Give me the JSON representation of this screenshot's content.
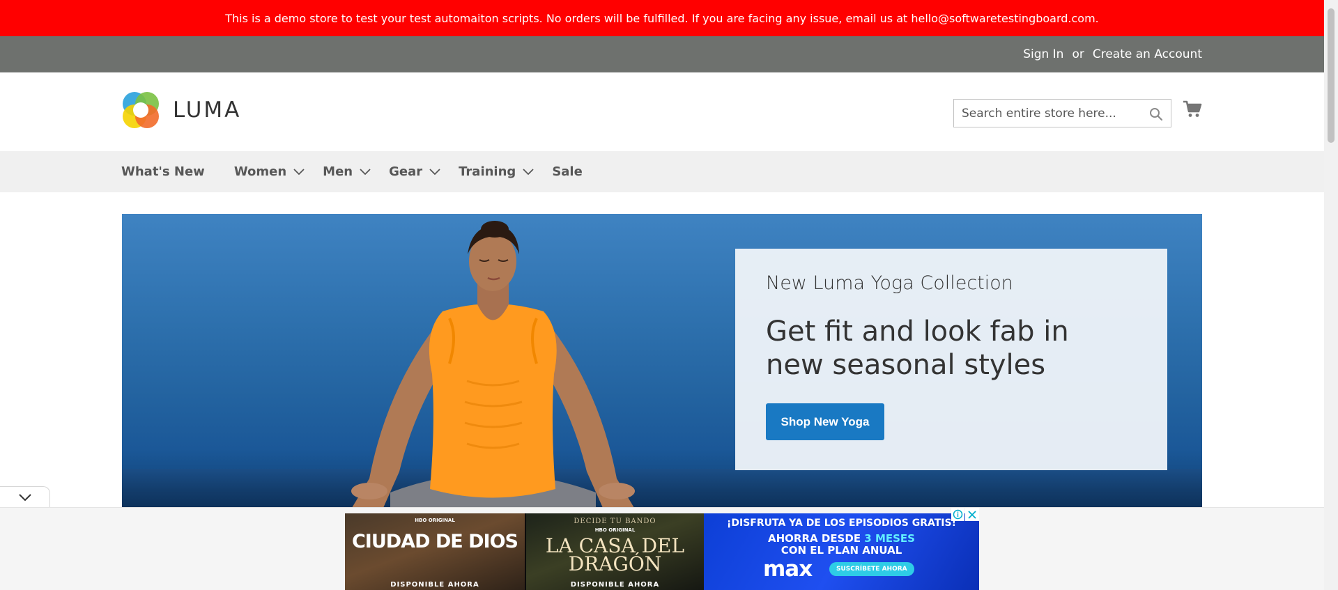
{
  "demo_notice": {
    "text": "This is a demo store to test your test automaiton scripts. No orders will be fulfilled. If you are facing any issue, email us at hello@softwaretestingboard.com."
  },
  "panel": {
    "sign_in": "Sign In",
    "or": "or",
    "create_account": "Create an Account"
  },
  "logo": {
    "text": "LUMA"
  },
  "search": {
    "placeholder": "Search entire store here..."
  },
  "nav": {
    "items": [
      {
        "label": "What's New",
        "has_submenu": false
      },
      {
        "label": "Women",
        "has_submenu": true
      },
      {
        "label": "Men",
        "has_submenu": true
      },
      {
        "label": "Gear",
        "has_submenu": true
      },
      {
        "label": "Training",
        "has_submenu": true
      },
      {
        "label": "Sale",
        "has_submenu": false
      }
    ]
  },
  "hero": {
    "subtitle": "New Luma Yoga Collection",
    "title": "Get fit and look fab in new seasonal styles",
    "button_label": "Shop New Yoga"
  },
  "ad": {
    "panel1": {
      "network": "HBO ORIGINAL",
      "show": "CIUDAD DE DIOS",
      "availability": "DISPONIBLE AHORA"
    },
    "panel2": {
      "tagline": "DECIDE TU BANDO",
      "network": "HBO ORIGINAL",
      "show": "LA CASA DEL DRAGÓN",
      "availability": "DISPONIBLE AHORA"
    },
    "panel3": {
      "headline": "¡DISFRUTA YA DE LOS EPISODIOS GRATIS!",
      "offer_prefix": "AHORRA DESDE",
      "offer_highlight": "3 MESES",
      "offer_suffix": "CON EL PLAN ANUAL",
      "brand": "max",
      "cta": "SUSCRÍBETE AHORA"
    }
  },
  "colors": {
    "demo_notice_bg": "#ff0000",
    "panel_bg": "#6e716e",
    "nav_bg": "#f0f0f0",
    "primary_button": "#1979c3"
  }
}
